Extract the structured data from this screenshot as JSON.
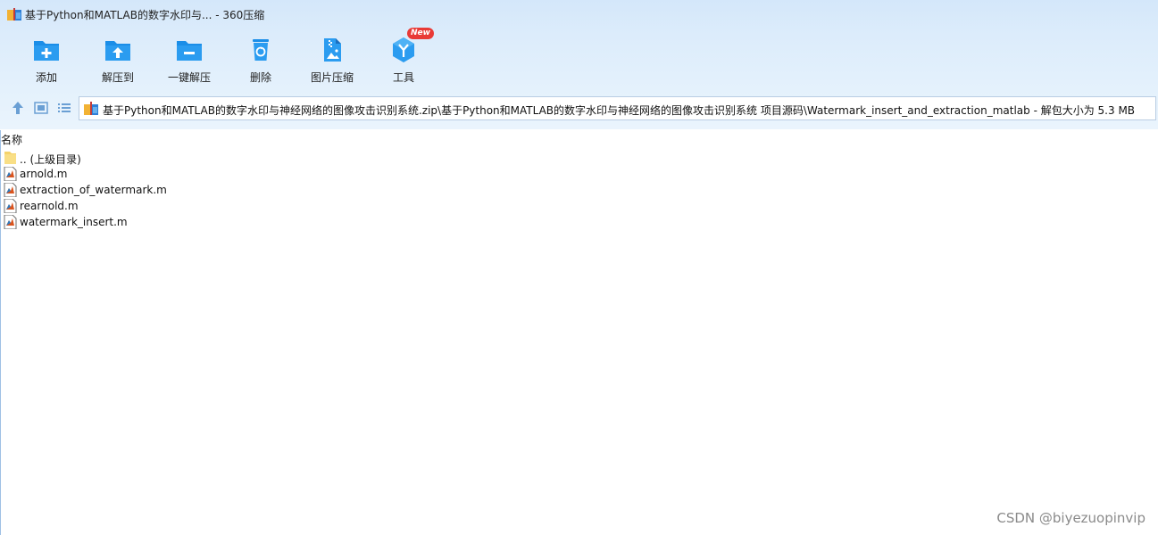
{
  "window": {
    "title": "基于Python和MATLAB的数字水印与... - 360压缩"
  },
  "toolbar": {
    "items": [
      {
        "label": "添加",
        "icon": "folder-add-icon"
      },
      {
        "label": "解压到",
        "icon": "folder-extract-icon"
      },
      {
        "label": "一键解压",
        "icon": "folder-quick-extract-icon"
      },
      {
        "label": "删除",
        "icon": "trash-icon"
      },
      {
        "label": "图片压缩",
        "icon": "image-compress-icon"
      },
      {
        "label": "工具",
        "icon": "tools-icon",
        "badge": "New"
      }
    ]
  },
  "address": {
    "path": "基于Python和MATLAB的数字水印与神经网络的图像攻击识别系统.zip\\基于Python和MATLAB的数字水印与神经网络的图像攻击识别系统 项目源码\\Watermark_insert_and_extraction_matlab - 解包大小为 5.3 MB"
  },
  "list": {
    "column_name": "名称",
    "items": [
      {
        "name": ".. (上级目录)",
        "type": "folder"
      },
      {
        "name": "arnold.m",
        "type": "file"
      },
      {
        "name": "extraction_of_watermark.m",
        "type": "file"
      },
      {
        "name": "rearnold.m",
        "type": "file"
      },
      {
        "name": "watermark_insert.m",
        "type": "file"
      }
    ]
  },
  "watermark": "CSDN @biyezuopinvip",
  "colors": {
    "accent": "#1b8ee8",
    "badge": "#e93a36"
  }
}
